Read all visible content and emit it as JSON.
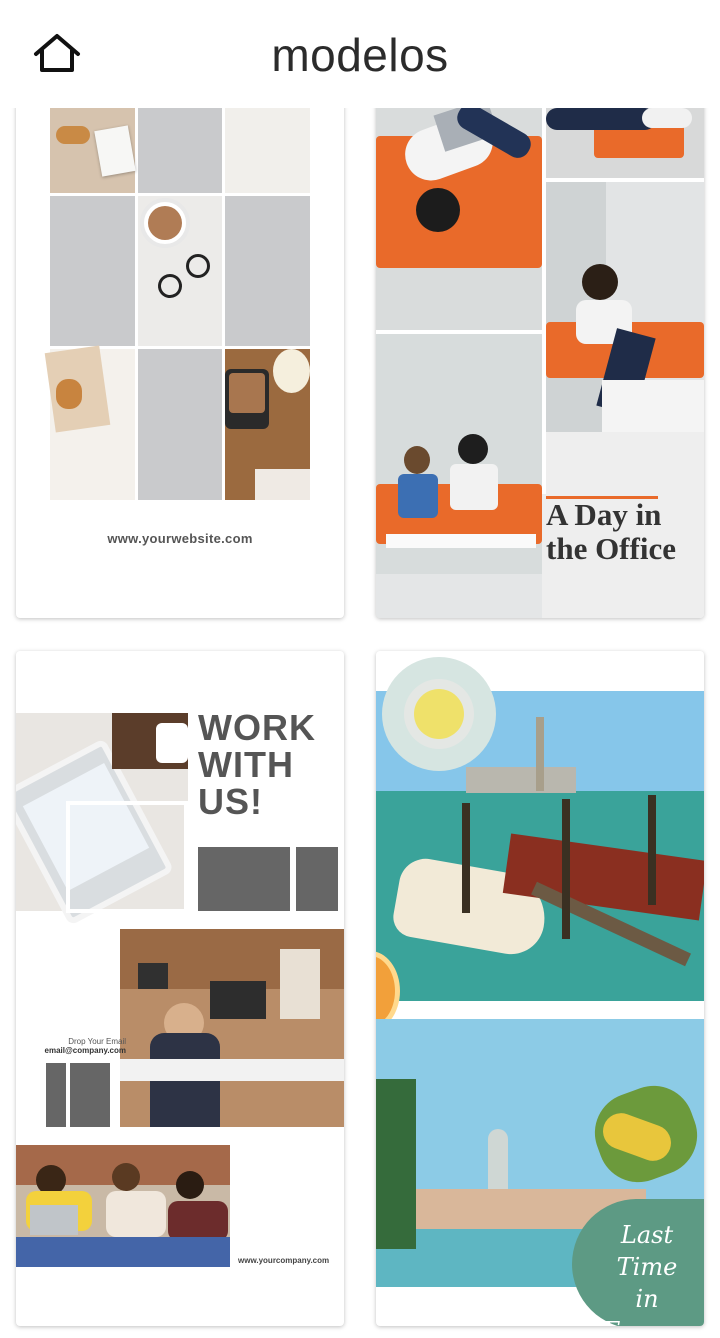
{
  "header": {
    "title": "modelos",
    "home_icon": "home-icon"
  },
  "templates": [
    {
      "website": "www.yourwebsite.com"
    },
    {
      "line1": "A Day in",
      "line2": "the Office"
    },
    {
      "headline1": "WORK",
      "headline2": "WITH",
      "headline3": "US!",
      "drop_label": "Drop Your Email",
      "email": "email@company.com",
      "company": "www.yourcompany.com"
    },
    {
      "line1": "Last Time",
      "line2": "in Europe"
    }
  ],
  "colors": {
    "orange": "#e96a2a",
    "gray": "#c9cacc",
    "dark_gray": "#666666",
    "sea": "#3aa39a",
    "sky": "#7cc2e6",
    "green_badge": "#5d9a84"
  }
}
